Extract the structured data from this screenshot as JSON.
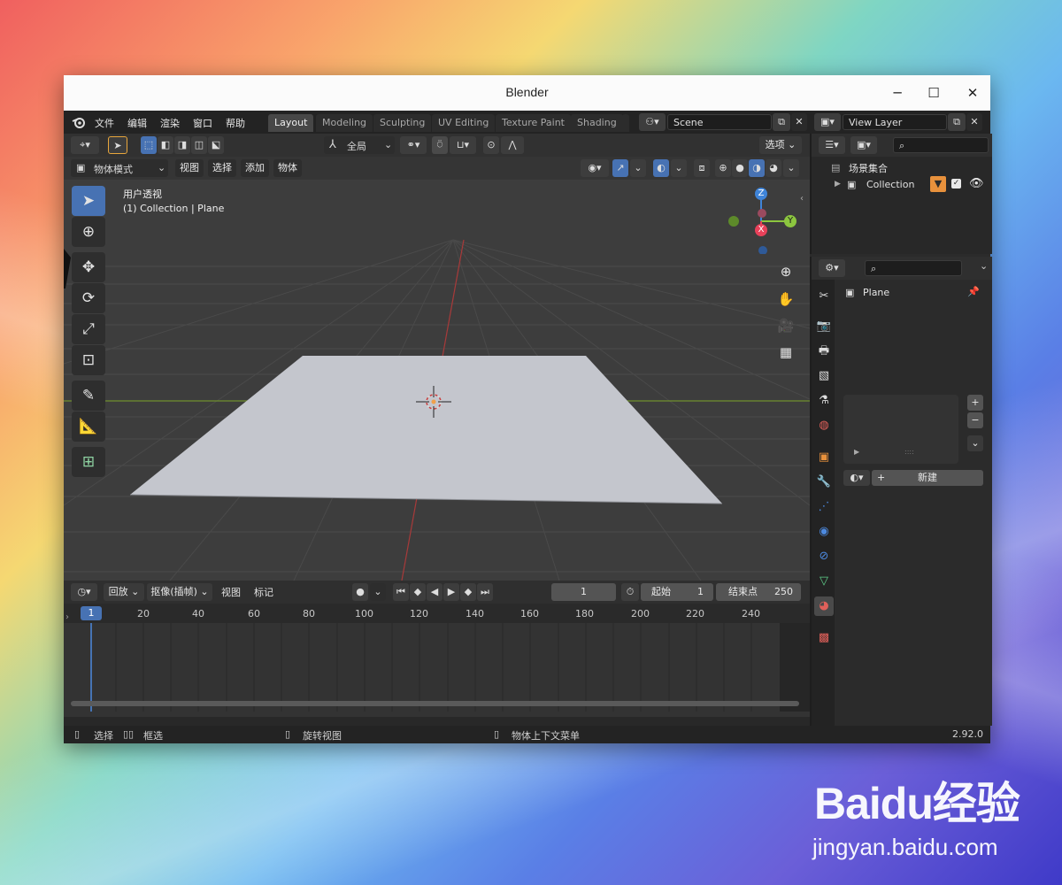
{
  "window": {
    "title": "Blender",
    "controls": {
      "minimize": "─",
      "maximize": "☐",
      "close": "✕"
    }
  },
  "topbar": {
    "menus": [
      "文件",
      "编辑",
      "渲染",
      "窗口",
      "帮助"
    ],
    "workspaces": [
      "Layout",
      "Modeling",
      "Sculpting",
      "UV Editing",
      "Texture Paint",
      "Shading"
    ],
    "active_workspace": "Layout",
    "scene": "Scene",
    "view_layer": "View Layer"
  },
  "viewport": {
    "header": {
      "transform_orientation": "全局",
      "options_label": "选项",
      "mode": "物体模式",
      "menus": [
        "视图",
        "选择",
        "添加",
        "物体"
      ]
    },
    "overlay_text": {
      "view_name": "用户透视",
      "context": "(1) Collection | Plane"
    },
    "gizmo_axes": {
      "z": "Z",
      "y": "Y",
      "x": "X"
    },
    "colors": {
      "background": "#3d3d3d",
      "plane": "#c4c6cd",
      "x_axis": "#c0393b",
      "y_axis": "#7ba22b",
      "active_tool": "#4772b3"
    }
  },
  "timeline": {
    "header": {
      "playback": "回放",
      "keying": "抠像(插帧)",
      "view": "视图",
      "marker": "标记"
    },
    "current_frame": "1",
    "start_label": "起始",
    "start_value": "1",
    "end_label": "结束点",
    "end_value": "250",
    "ruler_current": "1",
    "ruler_ticks": [
      "20",
      "40",
      "60",
      "80",
      "100",
      "120",
      "140",
      "160",
      "180",
      "200",
      "220",
      "240"
    ]
  },
  "outliner": {
    "root": "场景集合",
    "collection": "Collection"
  },
  "properties": {
    "object_name": "Plane",
    "new_button": "新建",
    "add": "+",
    "remove": "−",
    "handle": "::::"
  },
  "statusbar": {
    "select": "选择",
    "box_select": "框选",
    "rotate_view": "旋转视图",
    "context_menu": "物体上下文菜单",
    "version": "2.92.0"
  },
  "watermark": {
    "logo": "Baidu经验",
    "url": "jingyan.baidu.com"
  }
}
